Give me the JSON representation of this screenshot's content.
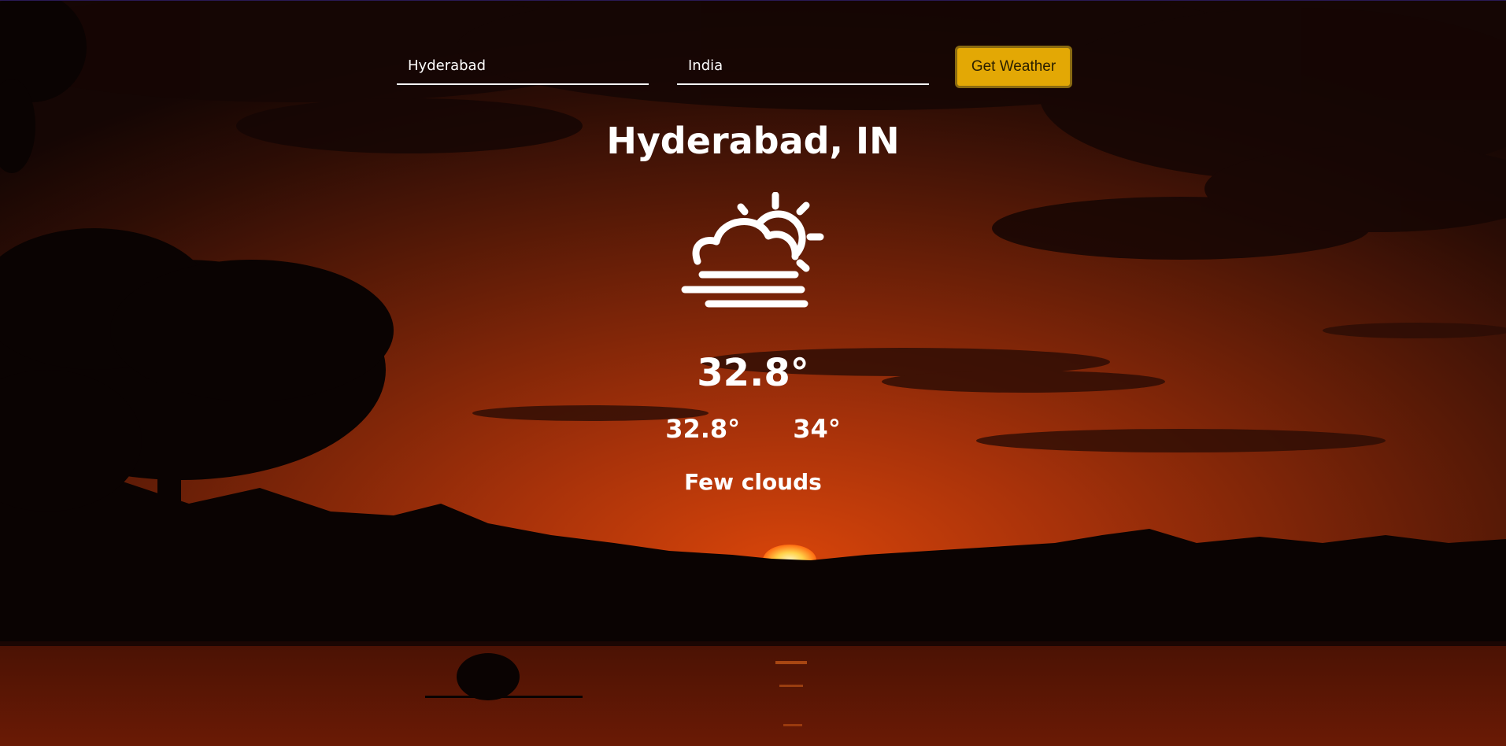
{
  "search": {
    "city_value": "Hyderabad",
    "country_value": "India",
    "button_label": "Get Weather"
  },
  "weather": {
    "location": "Hyderabad, IN",
    "icon": "sun-behind-cloud-haze-icon",
    "temperature": "32.8°",
    "temp_min": "32.8°",
    "temp_max": "34°",
    "description": "Few clouds"
  },
  "colors": {
    "button": "#e3a805",
    "text": "#ffffff",
    "sky_glow": "#c53a04"
  }
}
